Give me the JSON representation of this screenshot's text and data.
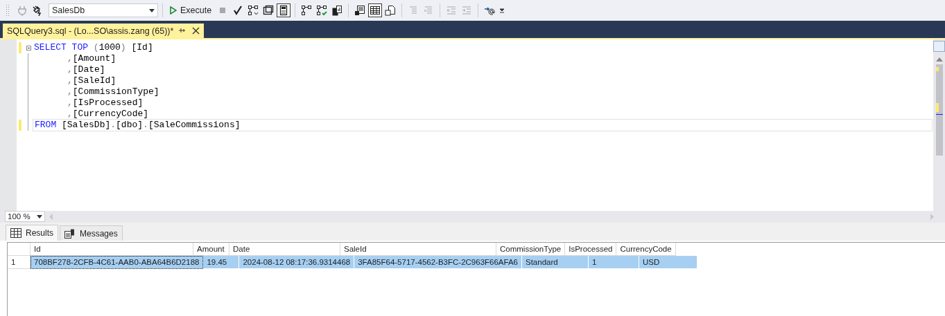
{
  "toolbar": {
    "items": [
      {
        "kind": "icon",
        "disabled": true,
        "selected": false
      },
      {
        "kind": "icon",
        "disabled": false,
        "selected": false
      },
      {
        "kind": "database",
        "value": "SalesDb"
      },
      {
        "kind": "separator"
      },
      {
        "kind": "execute",
        "label": "Execute",
        "disabled": false
      },
      {
        "kind": "icon",
        "disabled": true,
        "selected": false
      },
      {
        "kind": "icon",
        "disabled": false,
        "selected": false
      },
      {
        "kind": "icon",
        "disabled": false,
        "selected": false
      },
      {
        "kind": "icon",
        "disabled": false,
        "selected": false
      },
      {
        "kind": "icon",
        "disabled": false,
        "selected": true
      },
      {
        "kind": "separator"
      },
      {
        "kind": "icon",
        "disabled": false,
        "selected": false
      },
      {
        "kind": "icon",
        "disabled": false,
        "selected": false
      },
      {
        "kind": "icon",
        "disabled": false,
        "selected": false
      },
      {
        "kind": "separator"
      },
      {
        "kind": "icon",
        "disabled": false,
        "selected": false
      },
      {
        "kind": "icon",
        "disabled": false,
        "selected": true
      },
      {
        "kind": "icon",
        "disabled": false,
        "selected": false
      },
      {
        "kind": "separator"
      },
      {
        "kind": "icon",
        "disabled": true,
        "selected": false
      },
      {
        "kind": "icon",
        "disabled": true,
        "selected": false
      },
      {
        "kind": "separator"
      },
      {
        "kind": "icon",
        "disabled": true,
        "selected": false
      },
      {
        "kind": "icon",
        "disabled": true,
        "selected": false
      },
      {
        "kind": "separator"
      },
      {
        "kind": "icon",
        "disabled": false,
        "selected": false
      }
    ]
  },
  "document_tab": {
    "title": "SQLQuery3.sql - (Lo...SO\\assis.zang (65))*",
    "selected": true
  },
  "editor": {
    "lines": [
      {
        "modified": true,
        "current": false,
        "tokens": [
          {
            "kind": "keyword",
            "text": "SELECT TOP "
          },
          {
            "kind": "punct",
            "text": "("
          },
          {
            "kind": "plain",
            "text": "1000"
          },
          {
            "kind": "punct",
            "text": ")"
          },
          {
            "kind": "plain",
            "text": " [Id]"
          }
        ]
      },
      {
        "modified": false,
        "current": false,
        "tokens": [
          {
            "kind": "punct",
            "text": ","
          },
          {
            "kind": "plain",
            "text": "[Amount]"
          }
        ]
      },
      {
        "modified": false,
        "current": false,
        "tokens": [
          {
            "kind": "punct",
            "text": ","
          },
          {
            "kind": "plain",
            "text": "[Date]"
          }
        ]
      },
      {
        "modified": false,
        "current": false,
        "tokens": [
          {
            "kind": "punct",
            "text": ","
          },
          {
            "kind": "plain",
            "text": "[SaleId]"
          }
        ]
      },
      {
        "modified": false,
        "current": false,
        "tokens": [
          {
            "kind": "punct",
            "text": ","
          },
          {
            "kind": "plain",
            "text": "[CommissionType]"
          }
        ]
      },
      {
        "modified": false,
        "current": false,
        "tokens": [
          {
            "kind": "punct",
            "text": ","
          },
          {
            "kind": "plain",
            "text": "[IsProcessed]"
          }
        ]
      },
      {
        "modified": false,
        "current": false,
        "tokens": [
          {
            "kind": "punct",
            "text": ","
          },
          {
            "kind": "plain",
            "text": "[CurrencyCode]"
          }
        ]
      },
      {
        "modified": true,
        "current": true,
        "tokens": [
          {
            "kind": "keyword",
            "text": "FROM"
          },
          {
            "kind": "plain",
            "text": " [SalesDb]"
          },
          {
            "kind": "punct",
            "text": "."
          },
          {
            "kind": "plain",
            "text": "[dbo]"
          },
          {
            "kind": "punct",
            "text": "."
          },
          {
            "kind": "plain",
            "text": "[SaleCommissions]"
          }
        ]
      }
    ],
    "zoom": "100 %"
  },
  "result_tabs": [
    {
      "label": "Results",
      "selected": true
    },
    {
      "label": "Messages",
      "selected": false
    }
  ],
  "results": {
    "columns": [
      "Id",
      "Amount",
      "Date",
      "SaleId",
      "CommissionType",
      "IsProcessed",
      "CurrencyCode"
    ],
    "rows": [
      {
        "number": "1",
        "selected": true,
        "cells": [
          "708BF278-2CFB-4C61-AAB0-ABA64B6D2188",
          "19.45",
          "2024-08-12 08:17:36.9314468",
          "3FA85F64-5717-4562-B3FC-2C963F66AFA6",
          "Standard",
          "1",
          "USD"
        ]
      }
    ]
  }
}
